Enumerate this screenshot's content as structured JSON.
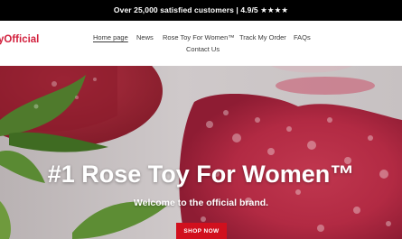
{
  "announcement": {
    "text": "Over 25,000 satisfied customers | 4.9/5 ★★★★"
  },
  "header": {
    "logo_text": "yOfficial",
    "nav": [
      {
        "label": "Home page",
        "active": true
      },
      {
        "label": "News"
      },
      {
        "label": "Rose Toy For Women™"
      },
      {
        "label": "Track My Order"
      },
      {
        "label": "FAQs"
      },
      {
        "label": "Contact Us"
      }
    ]
  },
  "hero": {
    "title": "#1 Rose Toy For Women™",
    "subtitle": "Welcome to the official brand.",
    "cta_label": "SHOP NOW"
  },
  "colors": {
    "announcement_bg": "#000000",
    "brand_red": "#d21f3c",
    "cta_bg": "#d1101e",
    "hero_bg": "#c9c3c4"
  }
}
